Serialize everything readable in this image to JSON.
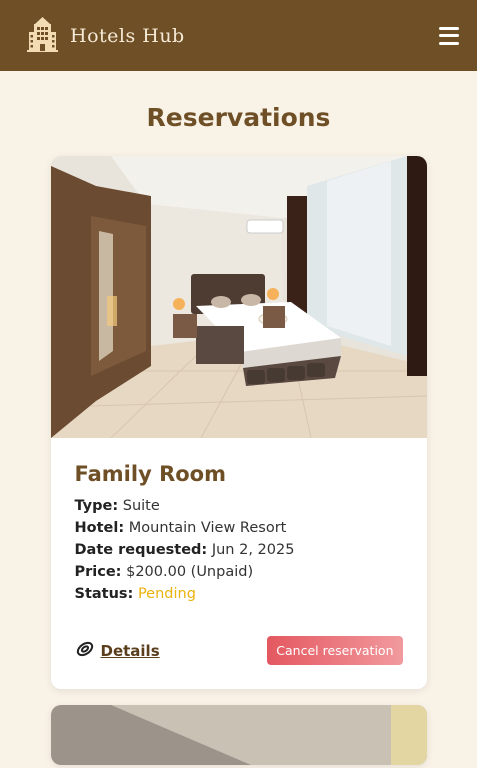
{
  "header": {
    "brand_name": "Hotels Hub",
    "logo_icon": "hotel-building-icon",
    "menu_icon": "hamburger-menu-icon"
  },
  "page": {
    "title": "Reservations"
  },
  "reservations": [
    {
      "room_name": "Family Room",
      "type_label": "Type:",
      "type_value": "Suite",
      "hotel_label": "Hotel:",
      "hotel_value": "Mountain View Resort",
      "date_label": "Date requested:",
      "date_value": "Jun 2, 2025",
      "price_label": "Price:",
      "price_value": "$200.00 (Unpaid)",
      "status_label": "Status:",
      "status_value": "Pending",
      "details_label": "Details",
      "cancel_label": "Cancel reservation"
    }
  ],
  "colors": {
    "header_bg": "#6e4f26",
    "page_bg": "#f9f2e7",
    "status_pending": "#eab20b",
    "cancel_button": "#e45860"
  }
}
